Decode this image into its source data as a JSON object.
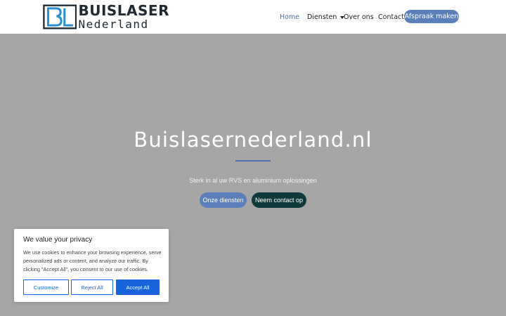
{
  "header": {
    "logo": {
      "top": "BUISLASER",
      "bottom": "Nederland",
      "mark": "BL"
    },
    "nav": [
      {
        "label": "Home"
      },
      {
        "label": "Diensten"
      },
      {
        "label": "Over ons"
      },
      {
        "label": "Contact"
      }
    ],
    "cta": "Afspraak maken"
  },
  "hero": {
    "title": "Buislasernederland.nl",
    "subtitle": "Sterk in al uw RVS en aluminium oplossingen",
    "primary_button": "Onze diensten",
    "secondary_button": "Neem contact op"
  },
  "cookie_banner": {
    "title": "We value your privacy",
    "text": "We use cookies to enhance your browsing experience, serve personalized ads or content, and analyze our traffic. By clicking \"Accept All\", you consent to our use of cookies.",
    "customize": "Customize",
    "reject": "Reject All",
    "accept": "Accept All"
  },
  "colors": {
    "accent": "#5b7fb8",
    "dark_teal": "#0f3a3c",
    "cookie_blue": "#1863dc",
    "hero_bg": "#a6a6a6"
  },
  "icons": {
    "dropdown": "chevron-down-icon",
    "logo": "logo-mark-icon"
  }
}
